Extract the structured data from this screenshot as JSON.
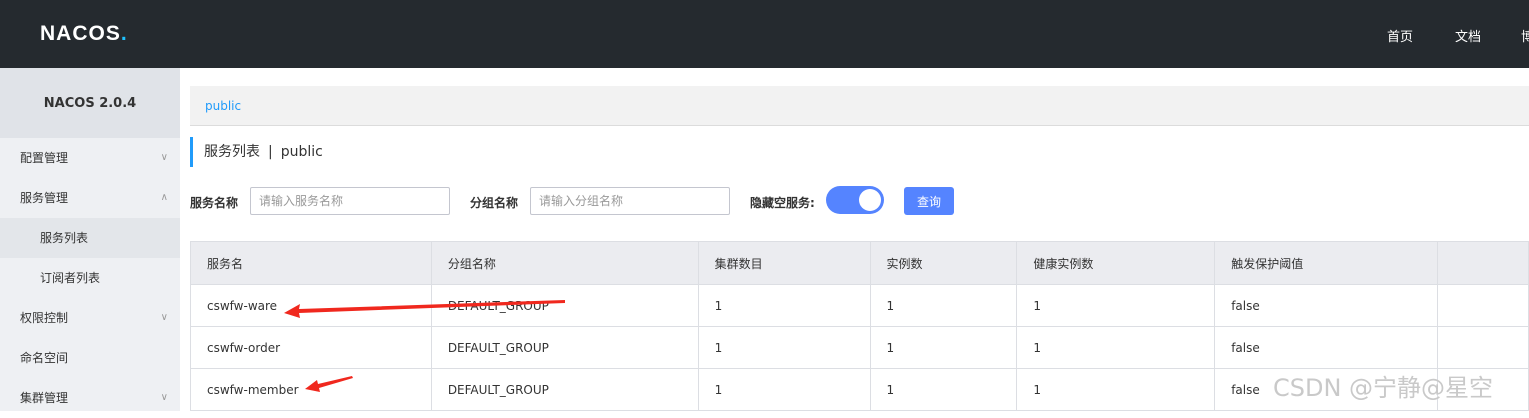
{
  "header": {
    "logo_text": "NACOS",
    "logo_dot": ".",
    "nav": [
      "首页",
      "文档",
      "博"
    ]
  },
  "sidebar": {
    "version": "NACOS 2.0.4",
    "items": [
      {
        "label": "配置管理"
      },
      {
        "label": "服务管理"
      },
      {
        "label": "服务列表"
      },
      {
        "label": "订阅者列表"
      },
      {
        "label": "权限控制"
      },
      {
        "label": "命名空间"
      },
      {
        "label": "集群管理"
      }
    ]
  },
  "breadcrumb": {
    "namespace": "public"
  },
  "page": {
    "title": "服务列表",
    "separator": "|",
    "namespace": "public"
  },
  "filters": {
    "service_name_label": "服务名称",
    "service_name_placeholder": "请输入服务名称",
    "group_name_label": "分组名称",
    "group_name_placeholder": "请输入分组名称",
    "hide_empty_label": "隐藏空服务:",
    "query_label": "查询"
  },
  "table": {
    "columns": [
      "服务名",
      "分组名称",
      "集群数目",
      "实例数",
      "健康实例数",
      "触发保护阈值"
    ],
    "rows": [
      [
        "cswfw-ware",
        "DEFAULT_GROUP",
        "1",
        "1",
        "1",
        "false"
      ],
      [
        "cswfw-order",
        "DEFAULT_GROUP",
        "1",
        "1",
        "1",
        "false"
      ],
      [
        "cswfw-member",
        "DEFAULT_GROUP",
        "1",
        "1",
        "1",
        "false"
      ]
    ]
  },
  "watermark": "CSDN @宁静@星空",
  "colors": {
    "topbar": "#252a2f",
    "accent": "#5584ff",
    "link": "#209bfa",
    "arrow": "#f0281e"
  }
}
